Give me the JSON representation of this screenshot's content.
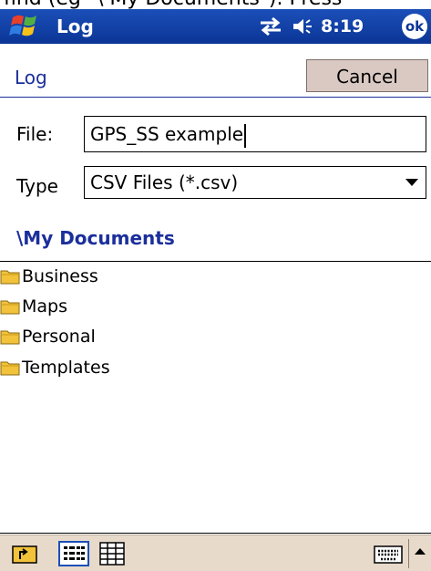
{
  "top_caption": "find (eg \"\\ My Documents\"). Press",
  "titlebar": {
    "app_title": "Log",
    "time": "8:19",
    "ok_label": "ok"
  },
  "header": {
    "label": "Log",
    "cancel_label": "Cancel"
  },
  "form": {
    "file_label": "File:",
    "file_value": "GPS_SS example",
    "type_label": "Type",
    "type_value": "CSV Files (*.csv)"
  },
  "folder_path": "\\My Documents",
  "folders": [
    {
      "label": "Business",
      "icon": "folder-icon"
    },
    {
      "label": "Maps",
      "icon": "folder-icon"
    },
    {
      "label": "Personal",
      "icon": "folder-icon"
    },
    {
      "label": "Templates",
      "icon": "folder-icon"
    }
  ],
  "colors": {
    "titlebar": "#0b3596",
    "accent_text": "#1b2f9c",
    "bottombar": "#e7dacb",
    "cancel_button": "#d9c9c2",
    "folder": "#f2c23a"
  },
  "icons": {
    "start": "windows-flag-icon",
    "connectivity": "connectivity-arrows-icon",
    "volume": "speaker-icon",
    "up_folder": "up-folder-icon",
    "list_view": "list-view-icon",
    "detail_view": "detail-view-icon",
    "keyboard": "keyboard-icon"
  }
}
